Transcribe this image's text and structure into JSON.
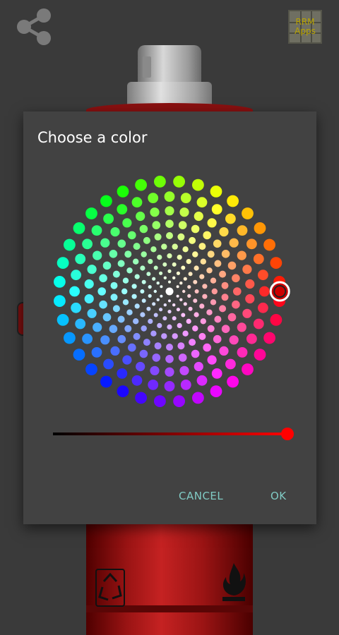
{
  "app": {
    "logo_line1": "RRM",
    "logo_line2": "Apps",
    "share_icon": "share-icon"
  },
  "dialog": {
    "title": "Choose a color",
    "selected_color": "#cc0000",
    "brightness": 1.0,
    "cancel_label": "CANCEL",
    "ok_label": "OK"
  },
  "colors": {
    "accent": "#80cbc4",
    "dialog_bg": "#424242",
    "page_bg": "#3a3a3a",
    "can_red": "#9b1414"
  }
}
